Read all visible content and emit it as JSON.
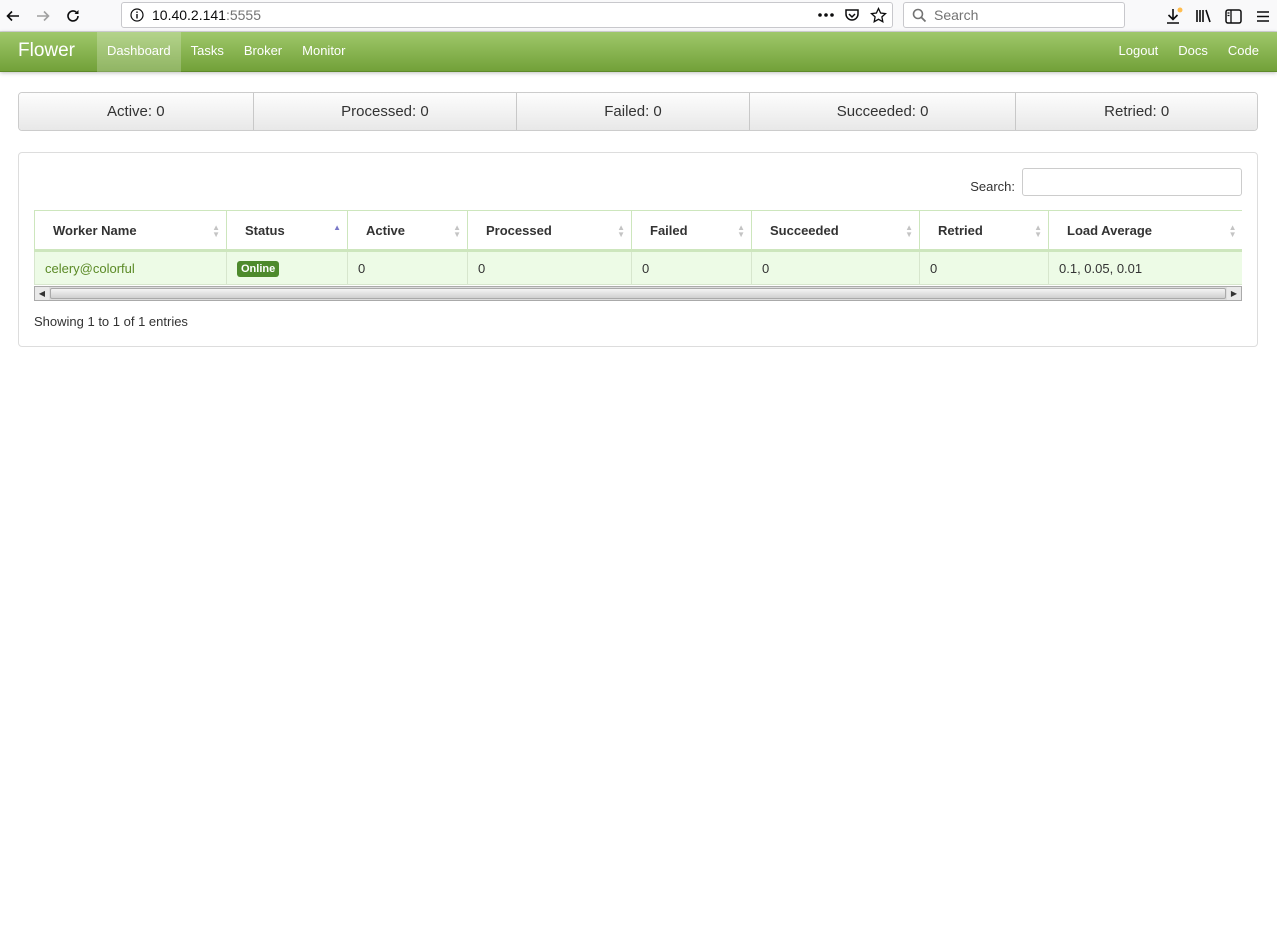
{
  "browser": {
    "url_host": "10.40.2.141",
    "url_port": ":5555",
    "search_placeholder": "Search"
  },
  "navbar": {
    "brand": "Flower",
    "items": [
      {
        "label": "Dashboard",
        "active": true
      },
      {
        "label": "Tasks"
      },
      {
        "label": "Broker"
      },
      {
        "label": "Monitor"
      }
    ],
    "right_items": [
      {
        "label": "Logout"
      },
      {
        "label": "Docs"
      },
      {
        "label": "Code"
      }
    ]
  },
  "summary": {
    "active": "Active: 0",
    "processed": "Processed: 0",
    "failed": "Failed: 0",
    "succeeded": "Succeeded: 0",
    "retried": "Retried: 0"
  },
  "table": {
    "search_label": "Search:",
    "search_value": "",
    "columns": [
      "Worker Name",
      "Status",
      "Active",
      "Processed",
      "Failed",
      "Succeeded",
      "Retried",
      "Load Average"
    ],
    "rows": [
      {
        "worker": "celery@colorful",
        "status": "Online",
        "active": "0",
        "processed": "0",
        "failed": "0",
        "succeeded": "0",
        "retried": "0",
        "load_average": "0.1, 0.05, 0.01"
      }
    ],
    "info": "Showing 1 to 1 of 1 entries"
  }
}
